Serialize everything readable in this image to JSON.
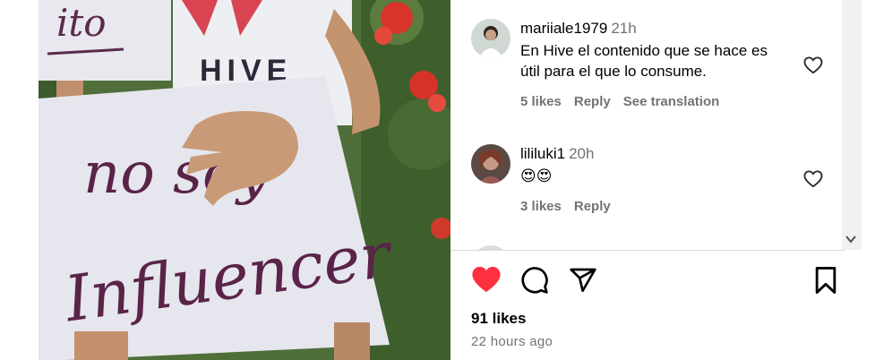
{
  "comments": [
    {
      "username": "mariiale1979",
      "time": "21h",
      "text": "En Hive el contenido que se hace es útil para el que lo consume.",
      "likes": "5 likes",
      "reply": "Reply",
      "translate": "See translation"
    },
    {
      "username": "lililuki1",
      "time": "20h",
      "text": "😍😍",
      "likes": "3 likes",
      "reply": "Reply"
    }
  ],
  "post": {
    "likes": "91 likes",
    "timestamp": "22 hours ago",
    "like_color": "#ff3040"
  },
  "photo": {
    "sign_upper_text": "ito",
    "sign_lower_line1": "no soy",
    "sign_lower_line2": "Influencer",
    "shirt_text": "HIVE"
  },
  "icons": [
    "heart-filled-icon",
    "comment-icon",
    "share-icon",
    "bookmark-icon",
    "heart-outline-icon",
    "chevron-down-icon"
  ]
}
